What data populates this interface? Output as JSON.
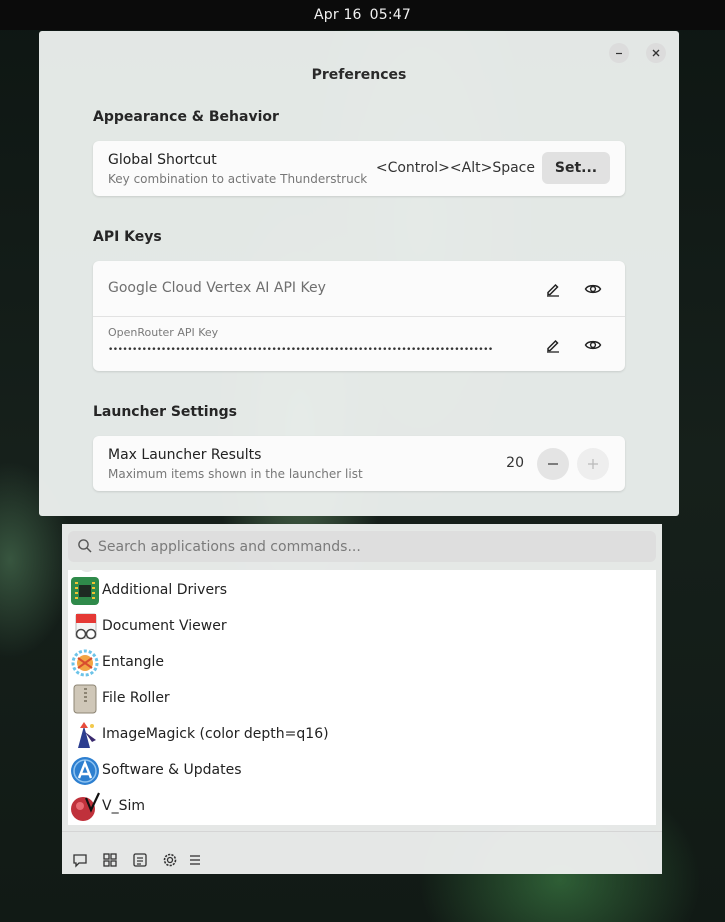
{
  "topbar": {
    "date": "Apr 16",
    "time": "05:47"
  },
  "preferences": {
    "title": "Preferences",
    "sections": {
      "appearance": {
        "title": "Appearance & Behavior",
        "global_shortcut": {
          "title": "Global Shortcut",
          "subtitle": "Key combination to activate Thunderstruck",
          "value": "<Control><Alt>Space",
          "button": "Set..."
        }
      },
      "api_keys": {
        "title": "API Keys",
        "google": {
          "placeholder": "Google Cloud Vertex AI API Key"
        },
        "openrouter": {
          "label": "OpenRouter API Key",
          "masked_value": "••••••••••••••••••••••••••••••••••••••••••••••••••••••••••••••••••••••••••••••••"
        }
      },
      "launcher": {
        "title": "Launcher Settings",
        "max_results": {
          "title": "Max Launcher Results",
          "subtitle": "Maximum items shown in the launcher list",
          "value": "20"
        }
      }
    }
  },
  "launcher": {
    "search_placeholder": "Search applications and commands...",
    "results": [
      {
        "name": "Additional Drivers",
        "icon": "chip-icon"
      },
      {
        "name": "Document Viewer",
        "icon": "document-viewer-icon"
      },
      {
        "name": "Entangle",
        "icon": "entangle-icon"
      },
      {
        "name": "File Roller",
        "icon": "archive-icon"
      },
      {
        "name": "ImageMagick (color depth=q16)",
        "icon": "imagemagick-icon"
      },
      {
        "name": "Software & Updates",
        "icon": "software-updates-icon"
      },
      {
        "name": "V_Sim",
        "icon": "vsim-icon"
      }
    ],
    "footer_icons": [
      "chat-icon",
      "grid-icon",
      "notes-icon",
      "settings-icon",
      "menu-icon"
    ]
  }
}
